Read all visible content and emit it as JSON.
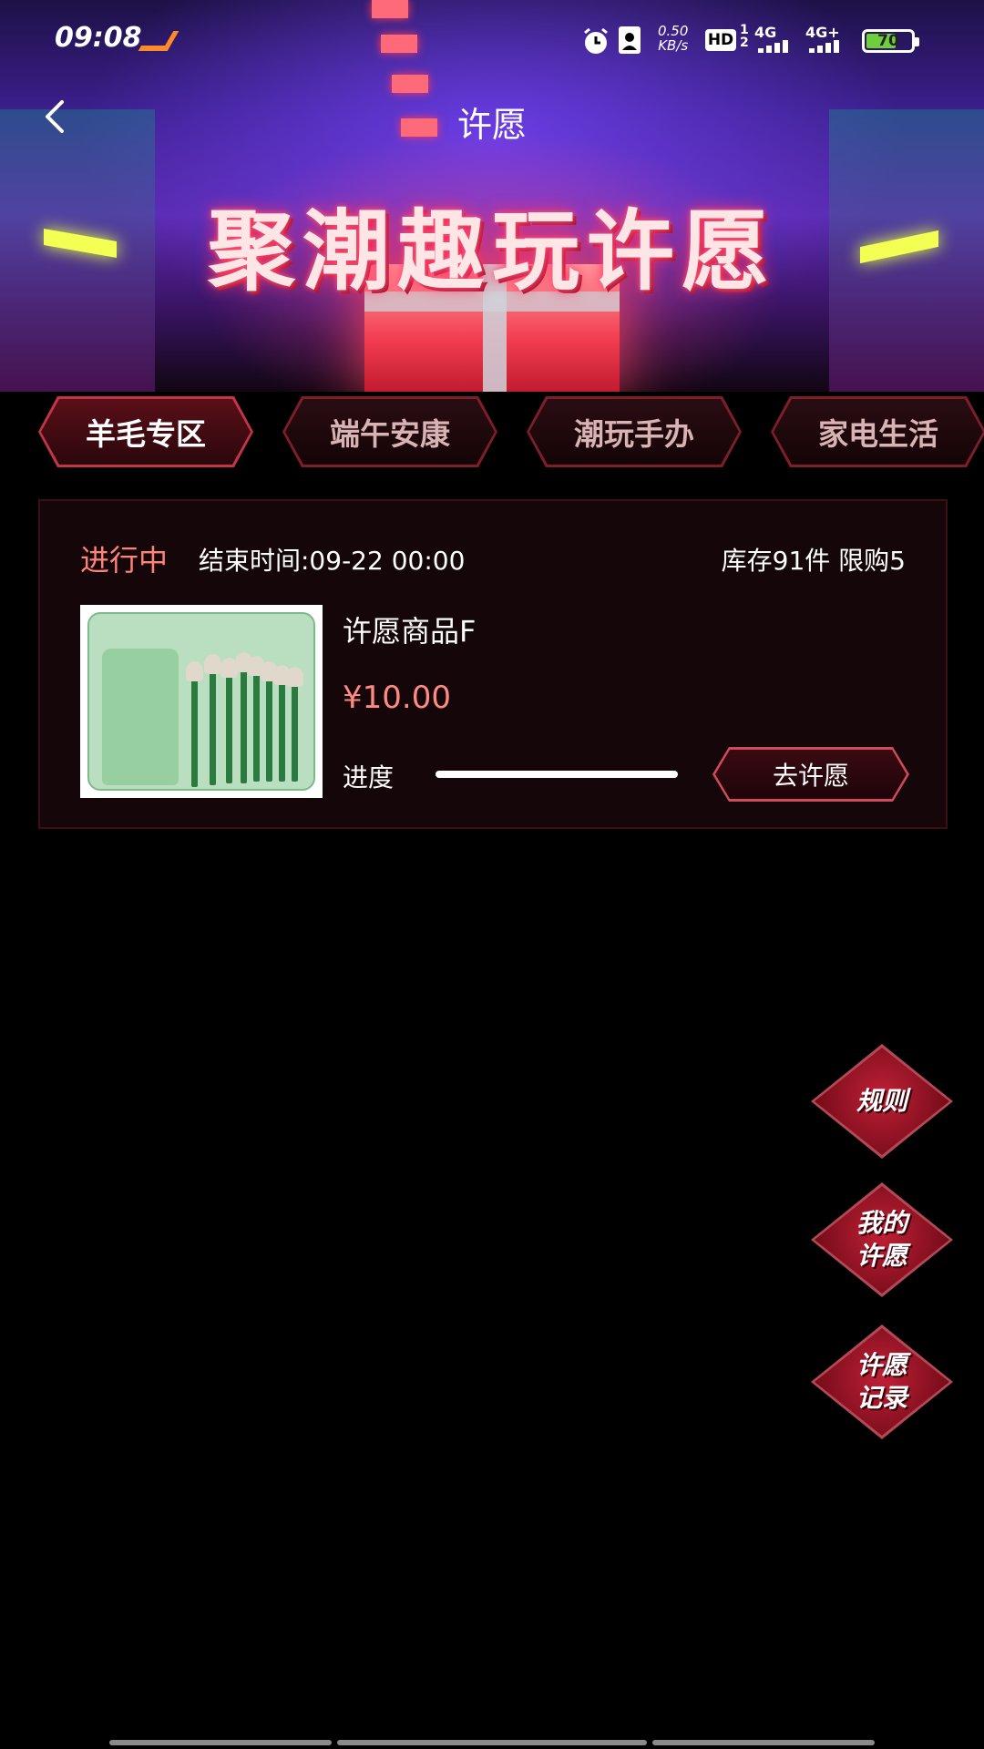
{
  "status_bar": {
    "time": "09:08",
    "net_speed": "0.50",
    "net_unit": "KB/s",
    "hd": "HD",
    "sim1": "4G",
    "sim2": "4G+",
    "battery_level": "70",
    "battery_fraction": 0.7
  },
  "nav": {
    "title": "许愿"
  },
  "banner": {
    "title": "聚潮趣玩许愿"
  },
  "tabs": [
    {
      "label": "羊毛专区",
      "active": true
    },
    {
      "label": "端午安康",
      "active": false
    },
    {
      "label": "潮玩手办",
      "active": false
    },
    {
      "label": "家电生活",
      "active": false
    }
  ],
  "card": {
    "status": "进行中",
    "end_time": "结束时间:09-22 00:00",
    "stock": "库存91件 限购5",
    "name": "许愿商品F",
    "price": "¥10.00",
    "progress_label": "进度",
    "progress": 1.0,
    "button": "去许愿"
  },
  "side_buttons": [
    {
      "label": "规则"
    },
    {
      "label": "我的\n许愿"
    },
    {
      "label": "许愿\n记录"
    }
  ],
  "colors": {
    "accent": "#ff8378",
    "price": "#ff8a80",
    "tab_active_border": "#c33447"
  }
}
